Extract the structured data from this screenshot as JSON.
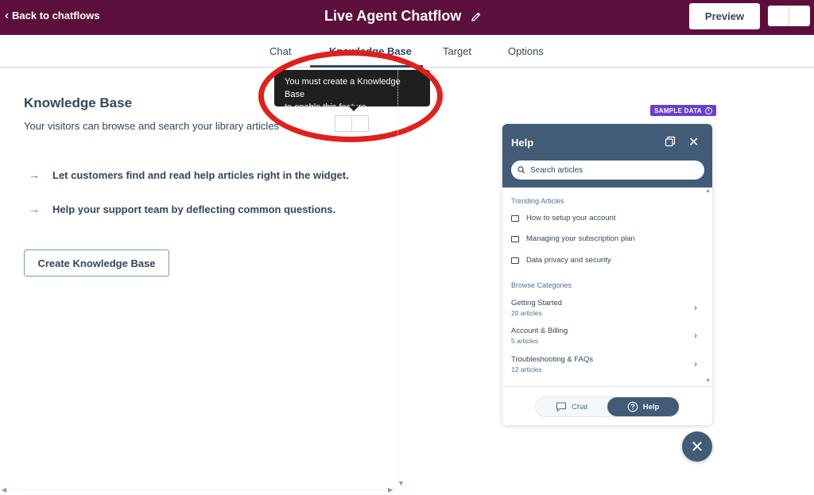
{
  "header": {
    "back_label": "Back to chatflows",
    "title": "Live Agent Chatflow",
    "preview_label": "Preview"
  },
  "tabs": [
    {
      "label": "Chat"
    },
    {
      "label": "Knowledge Base"
    },
    {
      "label": "Target"
    },
    {
      "label": "Options"
    }
  ],
  "tooltip": {
    "line1": "You must create a Knowledge Base",
    "line2": "to enable this feature"
  },
  "main": {
    "title": "Knowledge Base",
    "subtitle": "Your visitors can browse and search your library articles",
    "bullets": [
      "Let customers find and read help articles right in the widget.",
      "Help your support team by deflecting common questions."
    ],
    "create_label": "Create Knowledge Base"
  },
  "sample_badge": "SAMPLE DATA",
  "widget": {
    "title": "Help",
    "search_placeholder": "Search articles",
    "trending_label": "Trending Articles",
    "articles": [
      "How to setup your account",
      "Managing your subscription plan",
      "Data privacy and security"
    ],
    "categories_label": "Browse Categories",
    "categories": [
      {
        "name": "Getting Started",
        "count": "20 articles"
      },
      {
        "name": "Account & Billing",
        "count": "5 articles"
      },
      {
        "name": "Troubleshooting & FAQs",
        "count": "12 articles"
      }
    ],
    "chat_tab": "Chat",
    "help_tab": "Help"
  },
  "colors": {
    "topbar": "#5c0f3d",
    "widget_header": "#425b76",
    "sample_badge": "#6a3fd1",
    "highlight_circle": "#e0201b"
  }
}
